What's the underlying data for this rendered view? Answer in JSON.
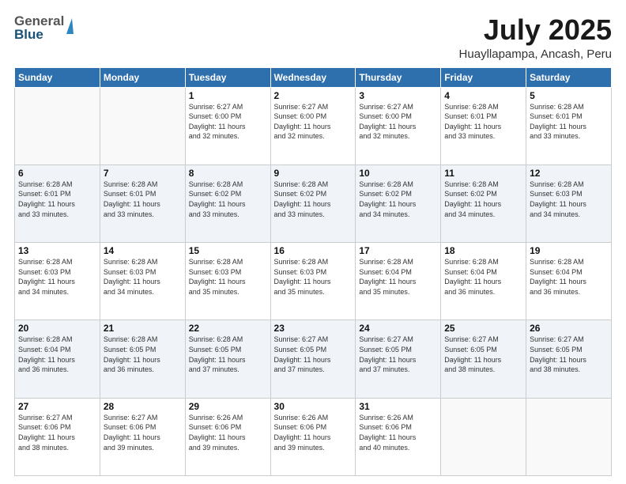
{
  "header": {
    "logo_general": "General",
    "logo_blue": "Blue",
    "month_title": "July 2025",
    "subtitle": "Huayllapampa, Ancash, Peru"
  },
  "days_of_week": [
    "Sunday",
    "Monday",
    "Tuesday",
    "Wednesday",
    "Thursday",
    "Friday",
    "Saturday"
  ],
  "weeks": [
    [
      {
        "day": "",
        "info": ""
      },
      {
        "day": "",
        "info": ""
      },
      {
        "day": "1",
        "info": "Sunrise: 6:27 AM\nSunset: 6:00 PM\nDaylight: 11 hours\nand 32 minutes."
      },
      {
        "day": "2",
        "info": "Sunrise: 6:27 AM\nSunset: 6:00 PM\nDaylight: 11 hours\nand 32 minutes."
      },
      {
        "day": "3",
        "info": "Sunrise: 6:27 AM\nSunset: 6:00 PM\nDaylight: 11 hours\nand 32 minutes."
      },
      {
        "day": "4",
        "info": "Sunrise: 6:28 AM\nSunset: 6:01 PM\nDaylight: 11 hours\nand 33 minutes."
      },
      {
        "day": "5",
        "info": "Sunrise: 6:28 AM\nSunset: 6:01 PM\nDaylight: 11 hours\nand 33 minutes."
      }
    ],
    [
      {
        "day": "6",
        "info": "Sunrise: 6:28 AM\nSunset: 6:01 PM\nDaylight: 11 hours\nand 33 minutes."
      },
      {
        "day": "7",
        "info": "Sunrise: 6:28 AM\nSunset: 6:01 PM\nDaylight: 11 hours\nand 33 minutes."
      },
      {
        "day": "8",
        "info": "Sunrise: 6:28 AM\nSunset: 6:02 PM\nDaylight: 11 hours\nand 33 minutes."
      },
      {
        "day": "9",
        "info": "Sunrise: 6:28 AM\nSunset: 6:02 PM\nDaylight: 11 hours\nand 33 minutes."
      },
      {
        "day": "10",
        "info": "Sunrise: 6:28 AM\nSunset: 6:02 PM\nDaylight: 11 hours\nand 34 minutes."
      },
      {
        "day": "11",
        "info": "Sunrise: 6:28 AM\nSunset: 6:02 PM\nDaylight: 11 hours\nand 34 minutes."
      },
      {
        "day": "12",
        "info": "Sunrise: 6:28 AM\nSunset: 6:03 PM\nDaylight: 11 hours\nand 34 minutes."
      }
    ],
    [
      {
        "day": "13",
        "info": "Sunrise: 6:28 AM\nSunset: 6:03 PM\nDaylight: 11 hours\nand 34 minutes."
      },
      {
        "day": "14",
        "info": "Sunrise: 6:28 AM\nSunset: 6:03 PM\nDaylight: 11 hours\nand 34 minutes."
      },
      {
        "day": "15",
        "info": "Sunrise: 6:28 AM\nSunset: 6:03 PM\nDaylight: 11 hours\nand 35 minutes."
      },
      {
        "day": "16",
        "info": "Sunrise: 6:28 AM\nSunset: 6:03 PM\nDaylight: 11 hours\nand 35 minutes."
      },
      {
        "day": "17",
        "info": "Sunrise: 6:28 AM\nSunset: 6:04 PM\nDaylight: 11 hours\nand 35 minutes."
      },
      {
        "day": "18",
        "info": "Sunrise: 6:28 AM\nSunset: 6:04 PM\nDaylight: 11 hours\nand 36 minutes."
      },
      {
        "day": "19",
        "info": "Sunrise: 6:28 AM\nSunset: 6:04 PM\nDaylight: 11 hours\nand 36 minutes."
      }
    ],
    [
      {
        "day": "20",
        "info": "Sunrise: 6:28 AM\nSunset: 6:04 PM\nDaylight: 11 hours\nand 36 minutes."
      },
      {
        "day": "21",
        "info": "Sunrise: 6:28 AM\nSunset: 6:05 PM\nDaylight: 11 hours\nand 36 minutes."
      },
      {
        "day": "22",
        "info": "Sunrise: 6:28 AM\nSunset: 6:05 PM\nDaylight: 11 hours\nand 37 minutes."
      },
      {
        "day": "23",
        "info": "Sunrise: 6:27 AM\nSunset: 6:05 PM\nDaylight: 11 hours\nand 37 minutes."
      },
      {
        "day": "24",
        "info": "Sunrise: 6:27 AM\nSunset: 6:05 PM\nDaylight: 11 hours\nand 37 minutes."
      },
      {
        "day": "25",
        "info": "Sunrise: 6:27 AM\nSunset: 6:05 PM\nDaylight: 11 hours\nand 38 minutes."
      },
      {
        "day": "26",
        "info": "Sunrise: 6:27 AM\nSunset: 6:05 PM\nDaylight: 11 hours\nand 38 minutes."
      }
    ],
    [
      {
        "day": "27",
        "info": "Sunrise: 6:27 AM\nSunset: 6:06 PM\nDaylight: 11 hours\nand 38 minutes."
      },
      {
        "day": "28",
        "info": "Sunrise: 6:27 AM\nSunset: 6:06 PM\nDaylight: 11 hours\nand 39 minutes."
      },
      {
        "day": "29",
        "info": "Sunrise: 6:26 AM\nSunset: 6:06 PM\nDaylight: 11 hours\nand 39 minutes."
      },
      {
        "day": "30",
        "info": "Sunrise: 6:26 AM\nSunset: 6:06 PM\nDaylight: 11 hours\nand 39 minutes."
      },
      {
        "day": "31",
        "info": "Sunrise: 6:26 AM\nSunset: 6:06 PM\nDaylight: 11 hours\nand 40 minutes."
      },
      {
        "day": "",
        "info": ""
      },
      {
        "day": "",
        "info": ""
      }
    ]
  ]
}
